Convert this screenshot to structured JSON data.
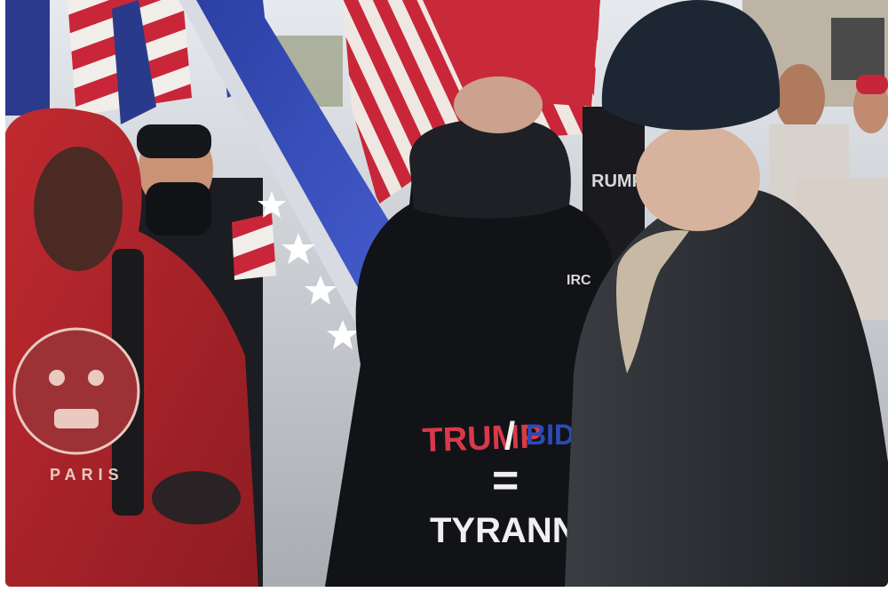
{
  "photo": {
    "shirt_print": {
      "line1_left": "TRUMP",
      "slash": "/",
      "line1_right": "BID",
      "equals": "=",
      "line2": "TYRANN"
    },
    "hoodie_print": {
      "brand": "PARIS"
    },
    "background_text": {
      "sleeve_text": "RUMP",
      "jacket_patch": "IRC"
    },
    "colors": {
      "sky": "#d9dfe6",
      "flag_red": "#c9263a",
      "flag_blue": "#2a3f9e",
      "hoodie_red": "#b8262c",
      "jacket_black": "#15171c",
      "print_red": "#d9394a",
      "print_blue": "#2e49b8"
    }
  }
}
